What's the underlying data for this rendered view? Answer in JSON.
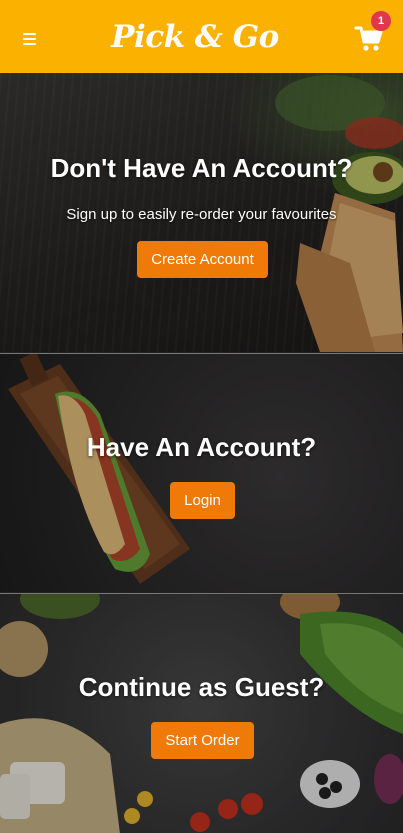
{
  "header": {
    "logo_text": "Pick & Go",
    "cart_count": "1",
    "brand_color": "#fbb100",
    "badge_color": "#e0374f"
  },
  "sections": [
    {
      "title": "Don't Have An Account?",
      "subtitle": "Sign up to easily re-order your favourites",
      "button_label": "Create Account"
    },
    {
      "title": "Have An Account?",
      "button_label": "Login"
    },
    {
      "title": "Continue as Guest?",
      "button_label": "Start Order"
    }
  ],
  "accent_color": "#f07a08",
  "icons": {
    "menu": "hamburger-icon",
    "cart": "cart-icon"
  }
}
